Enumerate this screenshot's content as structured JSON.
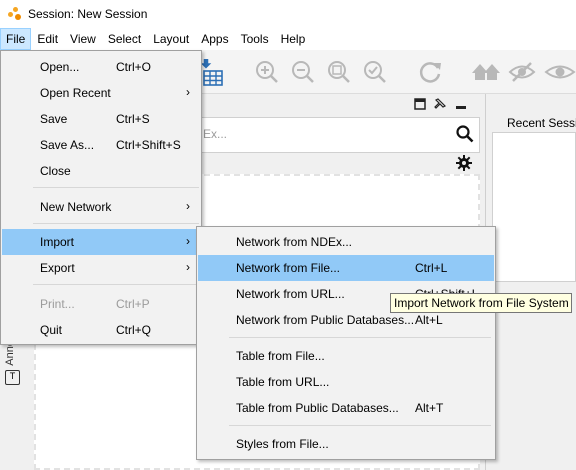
{
  "window": {
    "title": "Session: New Session"
  },
  "menubar": [
    "File",
    "Edit",
    "View",
    "Select",
    "Layout",
    "Apps",
    "Tools",
    "Help"
  ],
  "file_menu": {
    "items": [
      {
        "label": "Open...",
        "shortcut": "Ctrl+O",
        "submenu": false
      },
      {
        "label": "Open Recent",
        "shortcut": "",
        "submenu": true
      },
      {
        "label": "Save",
        "shortcut": "Ctrl+S",
        "submenu": false
      },
      {
        "label": "Save As...",
        "shortcut": "Ctrl+Shift+S",
        "submenu": false
      },
      {
        "label": "Close",
        "shortcut": "",
        "submenu": false
      },
      {
        "label": "New Network",
        "shortcut": "",
        "submenu": true
      },
      {
        "label": "Import",
        "shortcut": "",
        "submenu": true,
        "highlighted": true
      },
      {
        "label": "Export",
        "shortcut": "",
        "submenu": true
      },
      {
        "label": "Print...",
        "shortcut": "Ctrl+P",
        "submenu": false,
        "disabled": true
      },
      {
        "label": "Quit",
        "shortcut": "Ctrl+Q",
        "submenu": false
      }
    ]
  },
  "import_menu": {
    "items": [
      {
        "label": "Network from NDEx...",
        "shortcut": ""
      },
      {
        "label": "Network from File...",
        "shortcut": "Ctrl+L",
        "highlighted": true
      },
      {
        "label": "Network from URL...",
        "shortcut": "Ctrl+Shift+L"
      },
      {
        "label": "Network from Public Databases...",
        "shortcut": "Alt+L"
      },
      {
        "label": "Table from File...",
        "shortcut": ""
      },
      {
        "label": "Table from URL...",
        "shortcut": ""
      },
      {
        "label": "Table from Public Databases...",
        "shortcut": "Alt+T"
      },
      {
        "label": "Styles from File...",
        "shortcut": ""
      }
    ]
  },
  "tooltip": "Import Network from File System",
  "search": {
    "placeholder": "Ex..."
  },
  "right_panel": {
    "title": "Recent Sessions"
  },
  "side_tab": {
    "label": "Anno"
  },
  "colors": {
    "highlight": "#91c9f7",
    "menubar_active": "#cce8ff",
    "tooltip_bg": "#ffffe1",
    "import_icon": "#2c6fb5"
  }
}
